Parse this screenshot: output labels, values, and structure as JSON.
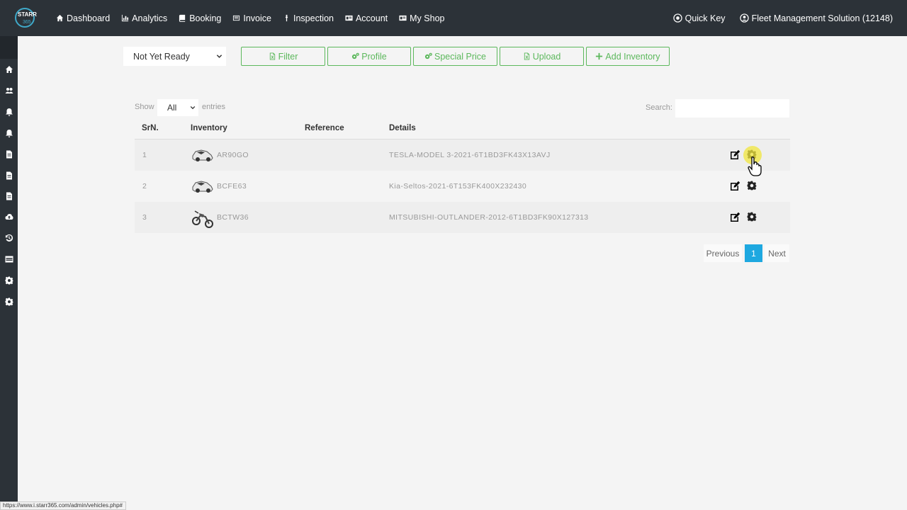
{
  "brand": {
    "logo_text": "STARR",
    "logo_sub": "365"
  },
  "nav": {
    "items": [
      {
        "label": "Dashboard",
        "icon": "home-icon"
      },
      {
        "label": "Analytics",
        "icon": "bar-chart-icon"
      },
      {
        "label": "Booking",
        "icon": "book-icon"
      },
      {
        "label": "Invoice",
        "icon": "invoice-icon"
      },
      {
        "label": "Inspection",
        "icon": "wrench-icon"
      },
      {
        "label": "Account",
        "icon": "id-card-icon"
      },
      {
        "label": "My Shop",
        "icon": "shop-icon"
      }
    ],
    "quick_key": "Quick Key",
    "user": "Fleet Management Solution (12148)"
  },
  "toolbar": {
    "status_value": "Not Yet Ready",
    "filter": "Filter",
    "profile": "Profile",
    "special_price": "Special Price",
    "upload": "Upload",
    "add_inventory": "Add Inventory"
  },
  "table_controls": {
    "show": "Show",
    "show_value": "All",
    "entries": "entries",
    "search": "Search:"
  },
  "table": {
    "headers": [
      "SrN.",
      "Inventory",
      "Reference",
      "Details"
    ],
    "rows": [
      {
        "srn": "1",
        "inventory": "AR90GO",
        "reference": "",
        "details": "TESLA-MODEL 3-2021-6T1BD3FK43X13AVJ",
        "thumb": "car-icon"
      },
      {
        "srn": "2",
        "inventory": "BCFE63",
        "reference": "",
        "details": "Kia-Seltos-2021-6T153FK400X232430",
        "thumb": "car-icon"
      },
      {
        "srn": "3",
        "inventory": "BCTW36",
        "reference": "",
        "details": "MITSUBISHI-OUTLANDER-2012-6T1BD3FK90X127313",
        "thumb": "motorcycle-icon"
      }
    ]
  },
  "pagination": {
    "previous": "Previous",
    "current": "1",
    "next": "Next"
  },
  "status_url": "https://www.i.starr365.com/admin/vehicles.php#",
  "colors": {
    "nav_bg": "#2c3238",
    "accent_green": "#5cb85c",
    "page_active": "#1ea8e0"
  }
}
